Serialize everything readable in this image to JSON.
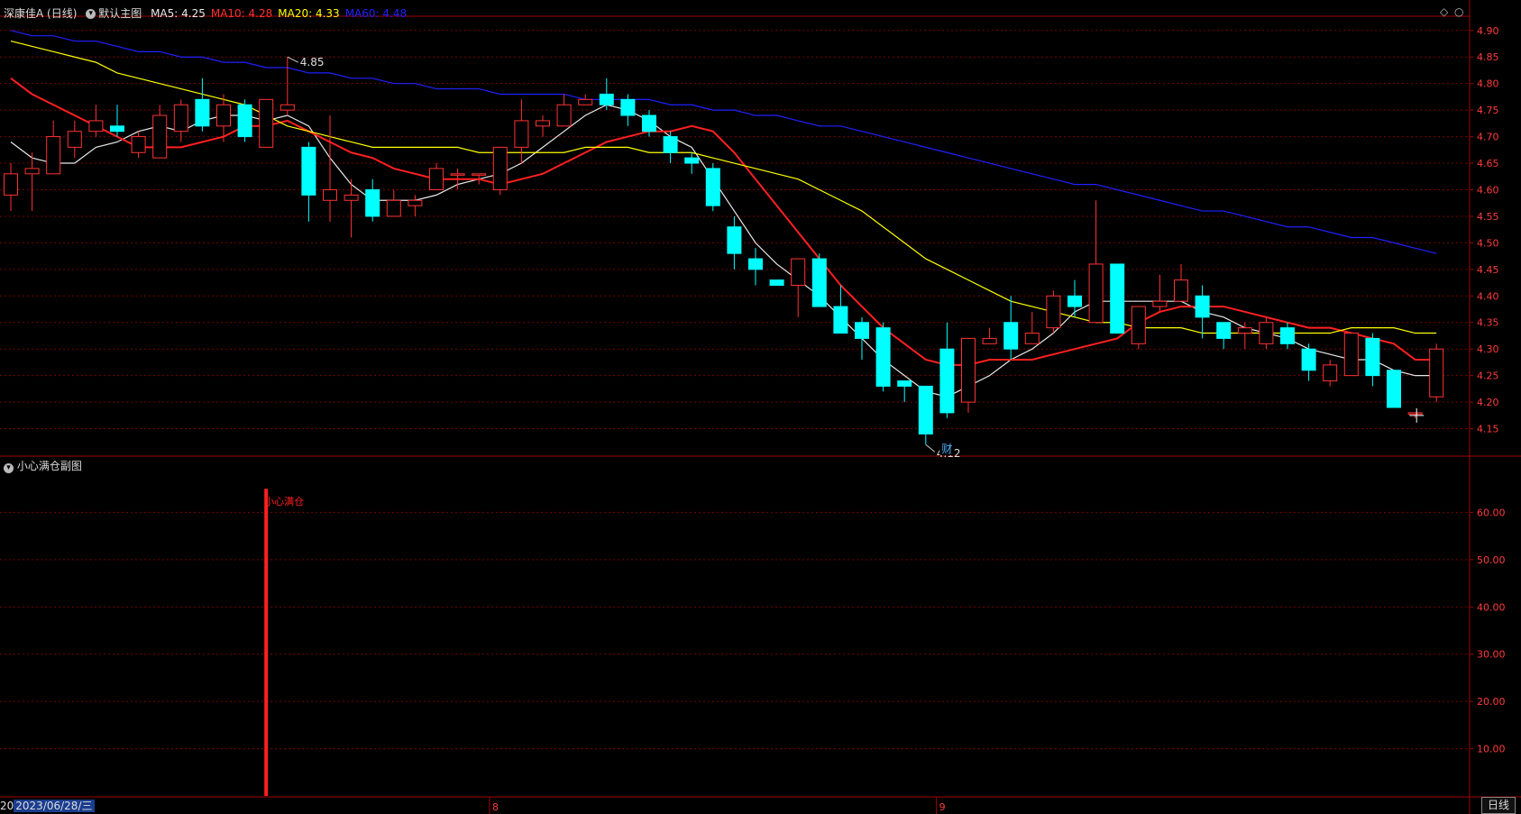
{
  "header": {
    "stock": "深康佳A (日线)",
    "main_label": "默认主图",
    "ma": [
      {
        "label": "MA5:",
        "value": "4.25",
        "color": "#e8e8e8"
      },
      {
        "label": "MA10:",
        "value": "4.28",
        "color": "#ff3030"
      },
      {
        "label": "MA20:",
        "value": "4.33",
        "color": "#ffff00"
      },
      {
        "label": "MA60:",
        "value": "4.48",
        "color": "#2020ff"
      }
    ]
  },
  "sub_panel": {
    "title": "小心满仓副图",
    "signal_label": "小心满仓",
    "y_ticks": [
      "60.00",
      "50.00",
      "40.00",
      "30.00",
      "20.00",
      "10.00"
    ]
  },
  "footer": {
    "date_prefix": "20",
    "date": "2023/06/28/三",
    "month_marks": [
      "8",
      "9"
    ],
    "period": "日线"
  },
  "annotations": {
    "high_label": "4.85",
    "low_label": "4.12",
    "event_label": "财"
  },
  "colors": {
    "up": "#ff3232",
    "down": "#00ffff",
    "grid": "#7a0000",
    "axis": "#a00000"
  },
  "chart_data": {
    "type": "candlestick",
    "y_ticks": [
      "4.90",
      "4.85",
      "4.80",
      "4.75",
      "4.70",
      "4.65",
      "4.60",
      "4.55",
      "4.50",
      "4.45",
      "4.40",
      "4.35",
      "4.30",
      "4.25",
      "4.20",
      "4.15"
    ],
    "ylim": [
      4.1,
      4.92
    ],
    "candles": [
      [
        4.59,
        4.63,
        4.56,
        4.65
      ],
      [
        4.63,
        4.64,
        4.56,
        4.67
      ],
      [
        4.63,
        4.7,
        4.63,
        4.73
      ],
      [
        4.68,
        4.71,
        4.66,
        4.73
      ],
      [
        4.71,
        4.73,
        4.7,
        4.76
      ],
      [
        4.72,
        4.71,
        4.7,
        4.76
      ],
      [
        4.67,
        4.7,
        4.66,
        4.71
      ],
      [
        4.66,
        4.74,
        4.66,
        4.76
      ],
      [
        4.71,
        4.76,
        4.69,
        4.77
      ],
      [
        4.77,
        4.72,
        4.71,
        4.81
      ],
      [
        4.72,
        4.76,
        4.69,
        4.78
      ],
      [
        4.76,
        4.7,
        4.69,
        4.77
      ],
      [
        4.68,
        4.77,
        4.68,
        4.77
      ],
      [
        4.75,
        4.76,
        4.74,
        4.85
      ],
      [
        4.68,
        4.59,
        4.54,
        4.69
      ],
      [
        4.58,
        4.6,
        4.54,
        4.74
      ],
      [
        4.58,
        4.59,
        4.51,
        4.62
      ],
      [
        4.6,
        4.55,
        4.54,
        4.62
      ],
      [
        4.55,
        4.58,
        4.55,
        4.6
      ],
      [
        4.57,
        4.58,
        4.55,
        4.59
      ],
      [
        4.6,
        4.64,
        4.6,
        4.65
      ],
      [
        4.63,
        4.63,
        4.6,
        4.64
      ],
      [
        4.63,
        4.63,
        4.61,
        4.63
      ],
      [
        4.6,
        4.68,
        4.59,
        4.68
      ],
      [
        4.68,
        4.73,
        4.65,
        4.77
      ],
      [
        4.72,
        4.73,
        4.7,
        4.74
      ],
      [
        4.72,
        4.76,
        4.72,
        4.78
      ],
      [
        4.76,
        4.77,
        4.76,
        4.78
      ],
      [
        4.78,
        4.76,
        4.75,
        4.81
      ],
      [
        4.77,
        4.74,
        4.72,
        4.78
      ],
      [
        4.74,
        4.71,
        4.7,
        4.75
      ],
      [
        4.7,
        4.67,
        4.65,
        4.71
      ],
      [
        4.66,
        4.65,
        4.63,
        4.67
      ],
      [
        4.64,
        4.57,
        4.56,
        4.65
      ],
      [
        4.53,
        4.48,
        4.45,
        4.55
      ],
      [
        4.47,
        4.45,
        4.42,
        4.49
      ],
      [
        4.43,
        4.42,
        4.42,
        4.43
      ],
      [
        4.42,
        4.47,
        4.36,
        4.47
      ],
      [
        4.47,
        4.38,
        4.38,
        4.48
      ],
      [
        4.38,
        4.33,
        4.33,
        4.42
      ],
      [
        4.35,
        4.32,
        4.28,
        4.36
      ],
      [
        4.34,
        4.23,
        4.22,
        4.35
      ],
      [
        4.24,
        4.23,
        4.2,
        4.24
      ],
      [
        4.23,
        4.14,
        4.12,
        4.23
      ],
      [
        4.3,
        4.18,
        4.17,
        4.35
      ],
      [
        4.2,
        4.32,
        4.18,
        4.32
      ],
      [
        4.31,
        4.32,
        4.31,
        4.34
      ],
      [
        4.35,
        4.3,
        4.28,
        4.4
      ],
      [
        4.31,
        4.33,
        4.31,
        4.37
      ],
      [
        4.34,
        4.4,
        4.33,
        4.41
      ],
      [
        4.4,
        4.38,
        4.36,
        4.43
      ],
      [
        4.35,
        4.46,
        4.35,
        4.58
      ],
      [
        4.46,
        4.33,
        4.33,
        4.46
      ],
      [
        4.31,
        4.38,
        4.3,
        4.38
      ],
      [
        4.38,
        4.39,
        4.37,
        4.44
      ],
      [
        4.39,
        4.43,
        4.39,
        4.46
      ],
      [
        4.4,
        4.36,
        4.32,
        4.42
      ],
      [
        4.35,
        4.32,
        4.3,
        4.35
      ],
      [
        4.33,
        4.34,
        4.3,
        4.35
      ],
      [
        4.31,
        4.35,
        4.3,
        4.36
      ],
      [
        4.34,
        4.31,
        4.3,
        4.35
      ],
      [
        4.3,
        4.26,
        4.24,
        4.31
      ],
      [
        4.24,
        4.27,
        4.23,
        4.28
      ],
      [
        4.25,
        4.33,
        4.25,
        4.33
      ],
      [
        4.32,
        4.25,
        4.23,
        4.33
      ],
      [
        4.26,
        4.19,
        4.19,
        4.26
      ],
      [
        4.18,
        4.18,
        4.17,
        4.18
      ],
      [
        4.21,
        4.3,
        4.2,
        4.31
      ]
    ],
    "candle_fields": [
      "open",
      "close",
      "low",
      "high"
    ],
    "series": [
      {
        "name": "MA5",
        "color": "#e8e8e8",
        "values": [
          4.69,
          4.66,
          4.65,
          4.65,
          4.68,
          4.69,
          4.71,
          4.72,
          4.71,
          4.73,
          4.74,
          4.74,
          4.73,
          4.74,
          4.72,
          4.66,
          4.61,
          4.58,
          4.58,
          4.58,
          4.59,
          4.61,
          4.62,
          4.63,
          4.65,
          4.68,
          4.71,
          4.74,
          4.76,
          4.75,
          4.73,
          4.7,
          4.68,
          4.62,
          4.56,
          4.5,
          4.46,
          4.43,
          4.4,
          4.36,
          4.32,
          4.28,
          4.25,
          4.22,
          4.21,
          4.23,
          4.25,
          4.28,
          4.3,
          4.33,
          4.37,
          4.39,
          4.39,
          4.39,
          4.39,
          4.39,
          4.37,
          4.36,
          4.34,
          4.33,
          4.32,
          4.3,
          4.29,
          4.28,
          4.28,
          4.26,
          4.25,
          4.25
        ]
      },
      {
        "name": "MA10",
        "color": "#ff2020",
        "values": [
          4.81,
          4.78,
          4.76,
          4.74,
          4.72,
          4.7,
          4.68,
          4.68,
          4.68,
          4.69,
          4.7,
          4.72,
          4.72,
          4.73,
          4.71,
          4.69,
          4.67,
          4.66,
          4.64,
          4.63,
          4.62,
          4.62,
          4.62,
          4.61,
          4.62,
          4.63,
          4.65,
          4.67,
          4.69,
          4.7,
          4.71,
          4.71,
          4.72,
          4.71,
          4.67,
          4.62,
          4.57,
          4.52,
          4.47,
          4.42,
          4.38,
          4.34,
          4.31,
          4.28,
          4.27,
          4.27,
          4.28,
          4.28,
          4.28,
          4.29,
          4.3,
          4.31,
          4.32,
          4.35,
          4.37,
          4.38,
          4.38,
          4.38,
          4.37,
          4.36,
          4.35,
          4.34,
          4.34,
          4.33,
          4.32,
          4.31,
          4.28,
          4.28
        ]
      },
      {
        "name": "MA20",
        "color": "#ffff00",
        "values": [
          4.88,
          4.87,
          4.86,
          4.85,
          4.84,
          4.82,
          4.81,
          4.8,
          4.79,
          4.78,
          4.77,
          4.76,
          4.74,
          4.72,
          4.71,
          4.7,
          4.69,
          4.68,
          4.68,
          4.68,
          4.68,
          4.68,
          4.67,
          4.67,
          4.67,
          4.67,
          4.67,
          4.68,
          4.68,
          4.68,
          4.67,
          4.67,
          4.67,
          4.66,
          4.65,
          4.64,
          4.63,
          4.62,
          4.6,
          4.58,
          4.56,
          4.53,
          4.5,
          4.47,
          4.45,
          4.43,
          4.41,
          4.39,
          4.38,
          4.37,
          4.36,
          4.35,
          4.35,
          4.34,
          4.34,
          4.34,
          4.33,
          4.33,
          4.33,
          4.33,
          4.33,
          4.33,
          4.33,
          4.34,
          4.34,
          4.34,
          4.33,
          4.33
        ]
      },
      {
        "name": "MA60",
        "color": "#2020ff",
        "values": [
          4.9,
          4.89,
          4.89,
          4.88,
          4.88,
          4.87,
          4.86,
          4.86,
          4.85,
          4.85,
          4.84,
          4.84,
          4.83,
          4.83,
          4.82,
          4.82,
          4.81,
          4.81,
          4.8,
          4.8,
          4.79,
          4.79,
          4.79,
          4.78,
          4.78,
          4.78,
          4.78,
          4.77,
          4.77,
          4.77,
          4.77,
          4.76,
          4.76,
          4.75,
          4.75,
          4.74,
          4.74,
          4.73,
          4.72,
          4.72,
          4.71,
          4.7,
          4.69,
          4.68,
          4.67,
          4.66,
          4.65,
          4.64,
          4.63,
          4.62,
          4.61,
          4.61,
          4.6,
          4.59,
          4.58,
          4.57,
          4.56,
          4.56,
          4.55,
          4.54,
          4.53,
          4.53,
          4.52,
          4.51,
          4.51,
          4.5,
          4.49,
          4.48
        ]
      }
    ],
    "high_index": 13,
    "low_index": 43,
    "event_index": 44,
    "signal_index": 12,
    "signal_value": 65.0,
    "sub_ylim": [
      0,
      70
    ]
  }
}
